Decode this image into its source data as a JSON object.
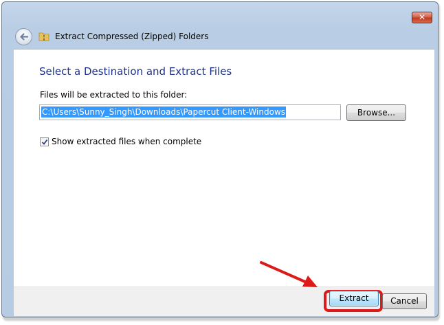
{
  "window": {
    "title": "Extract Compressed (Zipped) Folders",
    "close_label": "✕"
  },
  "main": {
    "heading": "Select a Destination and Extract Files",
    "folder_label": "Files will be extracted to this folder:",
    "path_value": "C:\\Users\\Sunny_Singh\\Downloads\\Papercut Client-Windows",
    "browse_label": "Browse...",
    "show_files_checked": true,
    "show_files_label": "Show extracted files when complete"
  },
  "footer": {
    "extract_label": "Extract",
    "cancel_label": "Cancel"
  },
  "annotation": {
    "color": "#dd1a1a"
  },
  "icons": [
    "close-icon",
    "back-arrow-icon",
    "zip-folder-icon",
    "checkmark-icon",
    "annotation-arrow"
  ]
}
